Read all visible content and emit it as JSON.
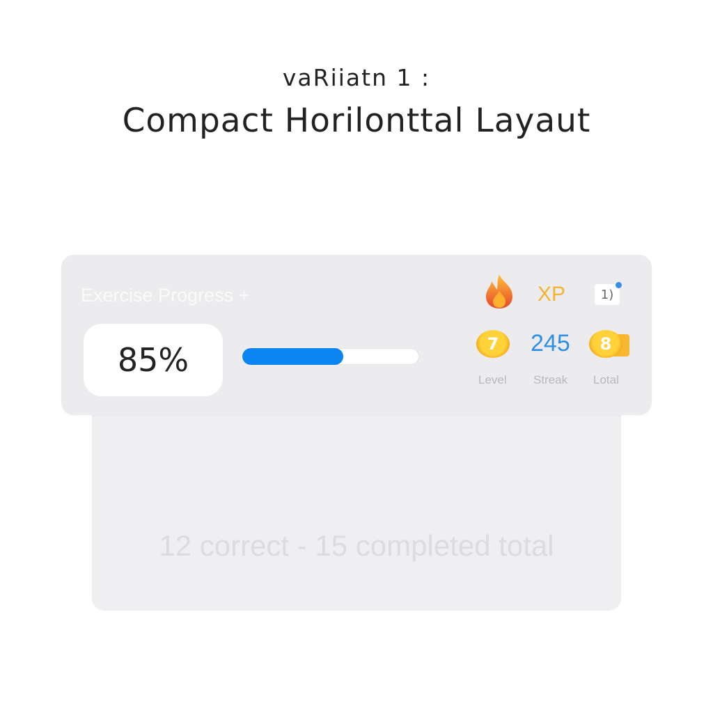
{
  "header": {
    "subtitle": "vaRiiatn 1 :",
    "title": "Compact Horilonttal Layaut"
  },
  "card": {
    "title": "Exercise Progress +",
    "percent_text": "85%",
    "bar_fill_percent": 57,
    "accent_color": "#0a84f0",
    "icons": {
      "flame": "flame-icon",
      "calendar": "calendar-icon",
      "coin": "coin-icon"
    },
    "xp_label": "XP",
    "calendar_text": "1)",
    "level_value": "7",
    "streak_value": "245",
    "total_value": "8",
    "labels": {
      "level": "Level",
      "streak": "Streak",
      "total": "Lotal"
    }
  },
  "summary": {
    "text": "12 correct - 15 completed  total"
  }
}
